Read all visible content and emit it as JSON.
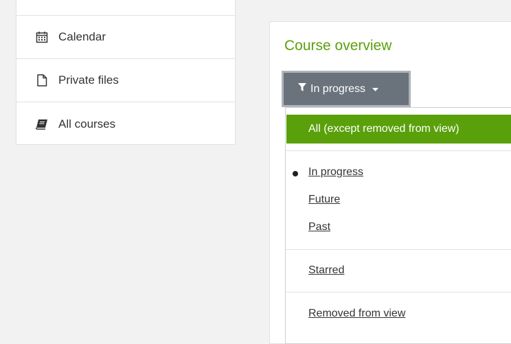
{
  "sidebar": {
    "items": [
      {
        "label": "Calendar",
        "icon": "calendar-icon"
      },
      {
        "label": "Private files",
        "icon": "file-icon"
      },
      {
        "label": "All courses",
        "icon": "book-icon"
      }
    ]
  },
  "course_overview": {
    "title": "Course overview",
    "filter_button": {
      "label": "In progress",
      "icon": "filter-icon",
      "caret": "caret-down-icon"
    },
    "dropdown": {
      "all_option": "All (except removed from view)",
      "options": [
        {
          "label": "In progress",
          "selected": true
        },
        {
          "label": "Future",
          "selected": false
        },
        {
          "label": "Past",
          "selected": false
        }
      ],
      "starred": "Starred",
      "removed": "Removed from view"
    }
  },
  "colors": {
    "accent_green": "#5aa00a",
    "filter_button_bg": "#6a737b",
    "page_bg": "#f2f2f2"
  }
}
